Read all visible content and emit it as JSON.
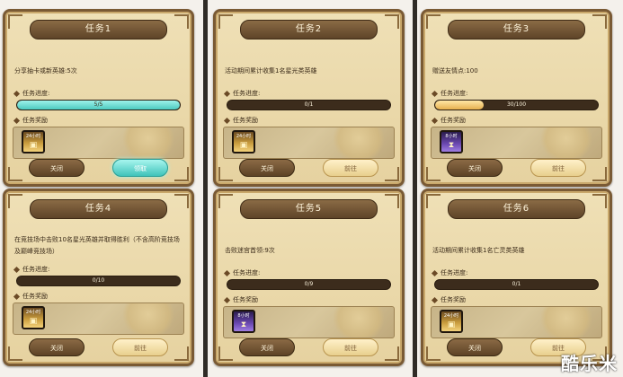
{
  "tasks": [
    {
      "title": "任务1",
      "desc": "分享抽卡或新英雄:5次",
      "progress_label": "任务进度:",
      "progress_text": "5/5",
      "progress_fraction": 1.0,
      "reward_label": "任务奖励",
      "item_text": "24小时",
      "item_color": "gold",
      "close_label": "关闭",
      "action_label": "领取",
      "action_style": "claim"
    },
    {
      "title": "任务2",
      "desc": "活动期间累计收集1名星光类英雄",
      "progress_label": "任务进度:",
      "progress_text": "0/1",
      "progress_fraction": 0.0,
      "reward_label": "任务奖励",
      "item_text": "24小时",
      "item_color": "gold",
      "close_label": "关闭",
      "action_label": "前往",
      "action_style": "go"
    },
    {
      "title": "任务3",
      "desc": "赠送友情点:100",
      "progress_label": "任务进度:",
      "progress_text": "30/100",
      "progress_fraction": 0.3,
      "reward_label": "任务奖励",
      "item_text": "8小时",
      "item_color": "purple",
      "close_label": "关闭",
      "action_label": "前往",
      "action_style": "go"
    },
    {
      "title": "任务4",
      "desc": "在竞技场中击败10名星光英雄并取得胜利（不含高阶竞技场及巅峰竞技场）",
      "progress_label": "任务进度:",
      "progress_text": "0/10",
      "progress_fraction": 0.0,
      "reward_label": "任务奖励",
      "item_text": "24小时",
      "item_color": "gold",
      "close_label": "关闭",
      "action_label": "前往",
      "action_style": "go"
    },
    {
      "title": "任务5",
      "desc": "击败迷宫首领:9次",
      "progress_label": "任务进度:",
      "progress_text": "0/9",
      "progress_fraction": 0.0,
      "reward_label": "任务奖励",
      "item_text": "8小时",
      "item_color": "purple",
      "close_label": "关闭",
      "action_label": "前往",
      "action_style": "go"
    },
    {
      "title": "任务6",
      "desc": "活动期间累计收集1名亡灵类英雄",
      "progress_label": "任务进度:",
      "progress_text": "0/1",
      "progress_fraction": 0.0,
      "reward_label": "任务奖励",
      "item_text": "24小时",
      "item_color": "gold",
      "close_label": "关闭",
      "action_label": "前往",
      "action_style": "go"
    }
  ],
  "watermark": "酷乐米",
  "colors": {
    "panel_bg": "#e6d2a0",
    "frame": "#7a5a34",
    "teal_fill": "#4ccac0",
    "gold_fill": "#e6b04e",
    "purple_item": "#6a48b0"
  }
}
